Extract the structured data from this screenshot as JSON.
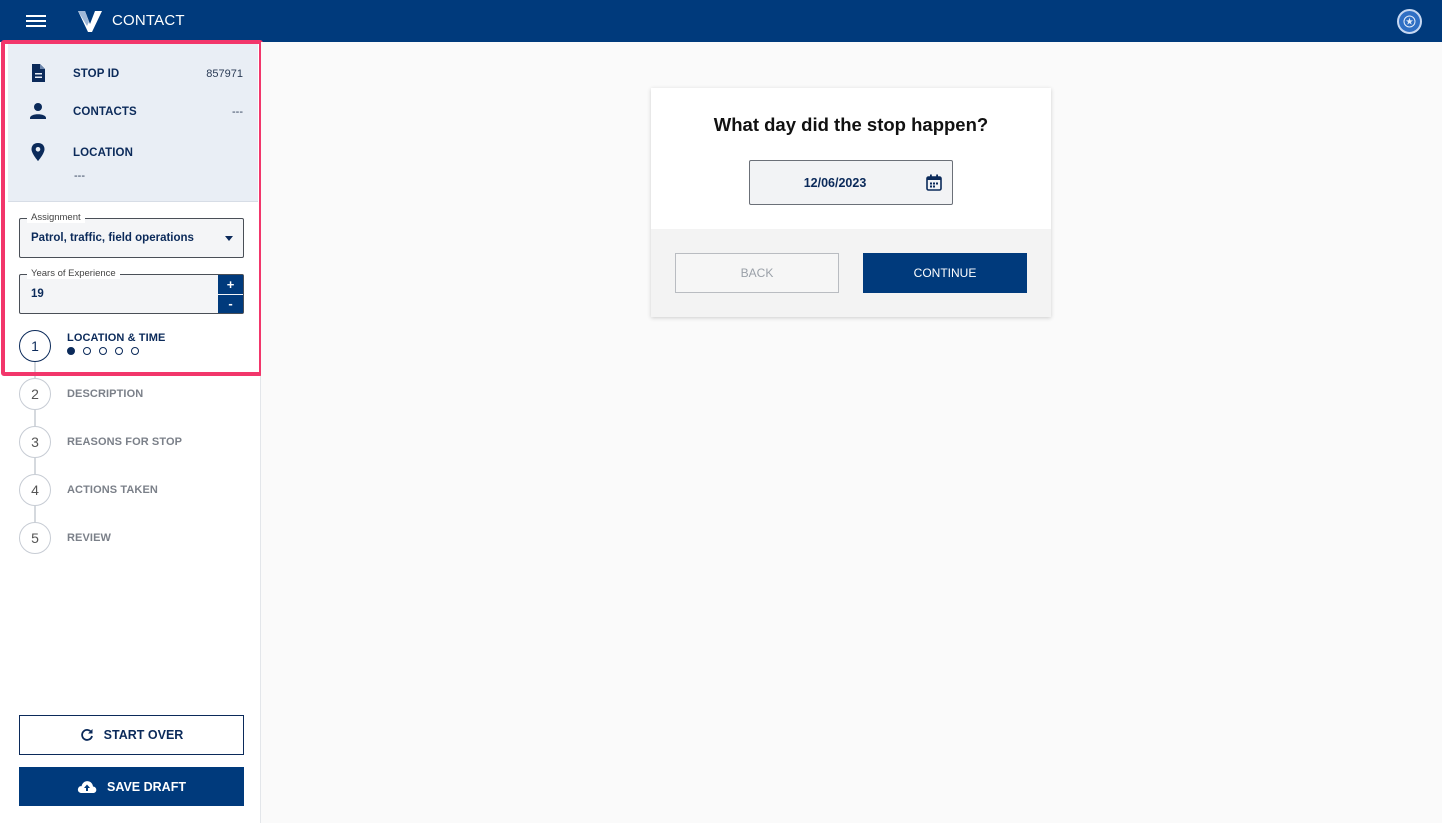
{
  "app": {
    "title": "CONTACT",
    "menu_icon": "hamburger-menu-icon",
    "logo_icon": "v-logo-icon",
    "profile_icon": "badge-icon"
  },
  "summary": {
    "stop_id_label": "STOP ID",
    "stop_id_value": "857971",
    "contacts_label": "CONTACTS",
    "contacts_value": "---",
    "location_label": "LOCATION",
    "location_value": "---"
  },
  "assignment": {
    "legend": "Assignment",
    "value": "Patrol, traffic, field operations"
  },
  "experience": {
    "legend": "Years of Experience",
    "value": "19",
    "plus": "+",
    "minus": "-"
  },
  "steps": [
    {
      "number": "1",
      "label": "LOCATION & TIME"
    },
    {
      "number": "2",
      "label": "DESCRIPTION"
    },
    {
      "number": "3",
      "label": "REASONS FOR STOP"
    },
    {
      "number": "4",
      "label": "ACTIONS TAKEN"
    },
    {
      "number": "5",
      "label": "REVIEW"
    }
  ],
  "progress": {
    "current_step": 1,
    "substeps_total": 5,
    "substeps_done": 1
  },
  "buttons": {
    "start_over": "START OVER",
    "save_draft": "SAVE DRAFT"
  },
  "question": {
    "title": "What day did the stop happen?",
    "date_value": "12/06/2023",
    "back_label": "BACK",
    "continue_label": "CONTINUE"
  },
  "colors": {
    "primary": "#003a7c",
    "highlight": "#f2366b",
    "summary_bg": "#e9eef5"
  }
}
